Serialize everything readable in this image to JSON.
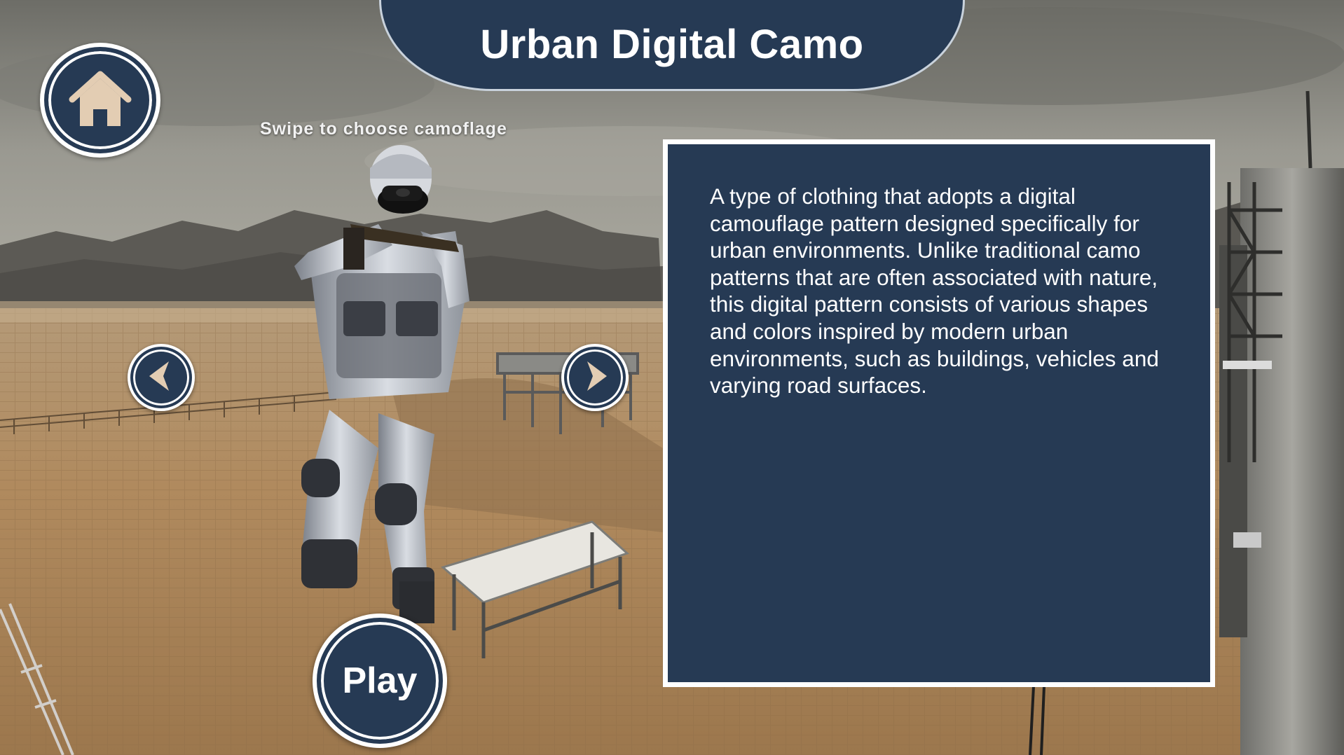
{
  "title": "Urban Digital Camo",
  "hint": "Swipe to choose camoflage",
  "description": "A type of clothing that adopts a digital camouflage pattern designed specifically for urban environments. Unlike traditional camo patterns that are often associated with nature, this digital pattern consists of various shapes and colors inspired by modern urban environments, such as buildings, vehicles and varying road surfaces.",
  "play_label": "Play",
  "icons": {
    "home": "home-icon",
    "previous": "chevron-left-icon",
    "next": "chevron-right-icon"
  },
  "colors": {
    "panel": "#263a54",
    "border": "#ffffff",
    "icon_fill": "#e3cdb3",
    "ground": "#b39068",
    "sky": "#9e9e97"
  }
}
